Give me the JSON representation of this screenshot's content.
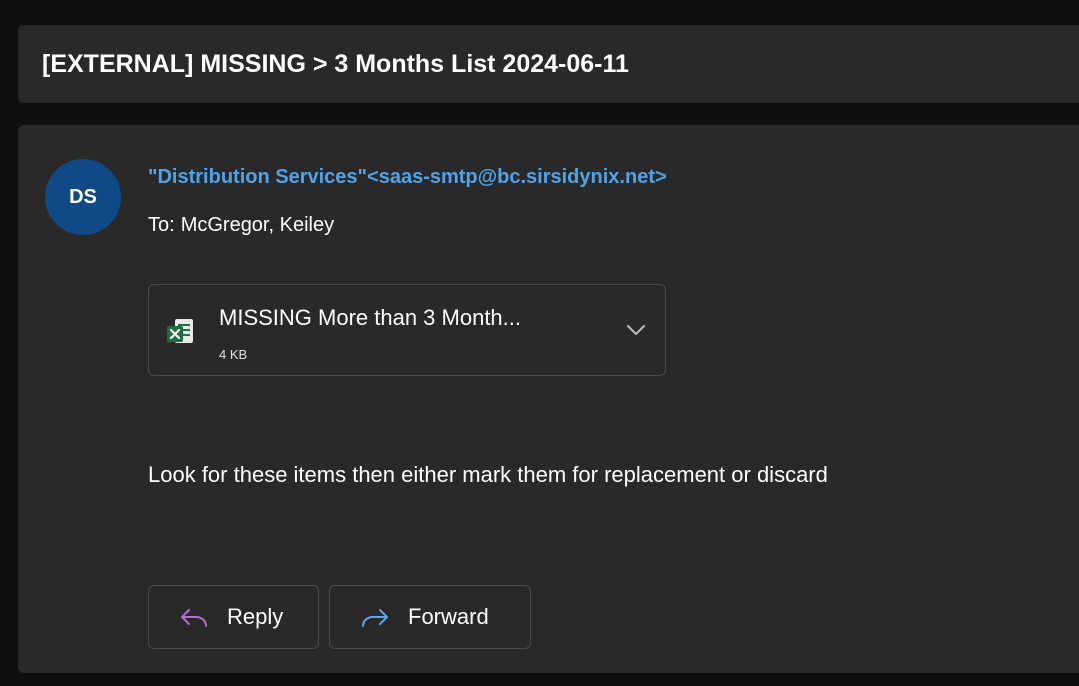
{
  "subject": "[EXTERNAL] MISSING > 3 Months List 2024-06-11",
  "sender": {
    "initials": "DS",
    "display": "\"Distribution Services\"<saas-smtp@bc.sirsidynix.net>",
    "avatar_color": "#0f4a86",
    "name_color": "#4fa3e8"
  },
  "recipient": {
    "label": "To:",
    "name": "McGregor, Keiley"
  },
  "attachment": {
    "name": "MISSING More than 3 Month...",
    "size": "4 KB",
    "icon": "excel-file-icon"
  },
  "body": {
    "text": "Look for these items then either mark them for replacement or discard"
  },
  "actions": {
    "reply_label": "Reply",
    "reply_icon": "reply-arrow-icon",
    "reply_icon_color": "#b46fc9",
    "forward_label": "Forward",
    "forward_icon": "forward-arrow-icon",
    "forward_icon_color": "#5aa7f0"
  }
}
